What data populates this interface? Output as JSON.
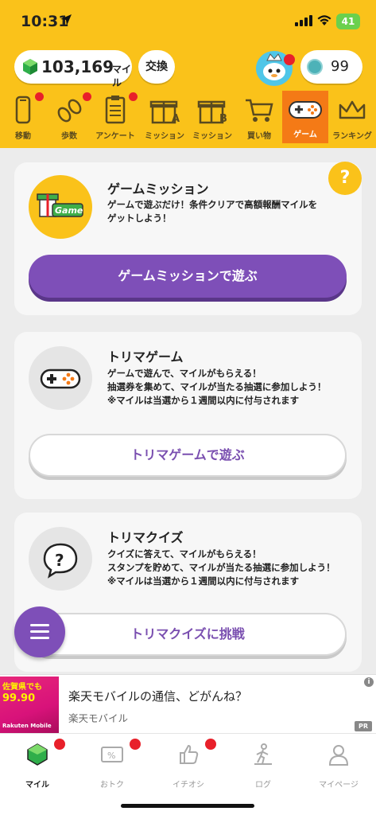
{
  "status_bar": {
    "time": "10:31",
    "battery": "41"
  },
  "header": {
    "miles_value": "103,169",
    "miles_unit": "マイル",
    "exchange_label": "交換",
    "coins_value": "99"
  },
  "tabs": [
    {
      "label": "移動",
      "icon": "phone-icon"
    },
    {
      "label": "歩数",
      "icon": "footsteps-icon"
    },
    {
      "label": "アンケート",
      "icon": "clipboard-icon"
    },
    {
      "label": "ミッション",
      "icon": "gift-a-icon"
    },
    {
      "label": "ミッション",
      "icon": "gift-b-icon"
    },
    {
      "label": "買い物",
      "icon": "cart-icon"
    },
    {
      "label": "ゲーム",
      "icon": "gamepad-icon"
    },
    {
      "label": "ランキング",
      "icon": "crown-icon"
    }
  ],
  "cards": {
    "game_mission": {
      "title": "ゲームミッション",
      "desc": "ゲームで遊ぶだけ！条件クリアで高額報酬マイルを\nゲットしよう！",
      "button": "ゲームミッションで遊ぶ",
      "icon_text": "Game"
    },
    "torima_game": {
      "title": "トリマゲーム",
      "desc": "ゲームで遊んで、マイルがもらえる！\n抽選券を集めて、マイルが当たる抽選に参加しよう！\n※マイルは当選から１週間以内に付与されます",
      "button": "トリマゲームで遊ぶ"
    },
    "torima_quiz": {
      "title": "トリマクイズ",
      "desc": "クイズに答えて、マイルがもらえる！\nスタンプを貯めて、マイルが当たる抽選に参加しよう！\n※マイルは当選から１週間以内に付与されます",
      "button": "トリマクイズに挑戦"
    }
  },
  "help_label": "?",
  "ad": {
    "title": "楽天モバイルの通信、どがんね？",
    "source": "楽天モバイル",
    "pr_label": "PR",
    "info_label": "i",
    "image_text_1": "佐賀県でも",
    "image_text_2": "99.90",
    "image_text_3": "Rakuten Mobile"
  },
  "bottom_nav": [
    {
      "label": "マイル",
      "icon": "gem-icon"
    },
    {
      "label": "おトク",
      "icon": "coupon-icon"
    },
    {
      "label": "イチオシ",
      "icon": "thumbs-up-icon"
    },
    {
      "label": "ログ",
      "icon": "walking-icon"
    },
    {
      "label": "マイページ",
      "icon": "person-icon"
    }
  ],
  "colors": {
    "header_bg": "#fac21a",
    "active_tab": "#f47a16",
    "primary_purple": "#7e4fb8",
    "notification_red": "#e8202a"
  }
}
